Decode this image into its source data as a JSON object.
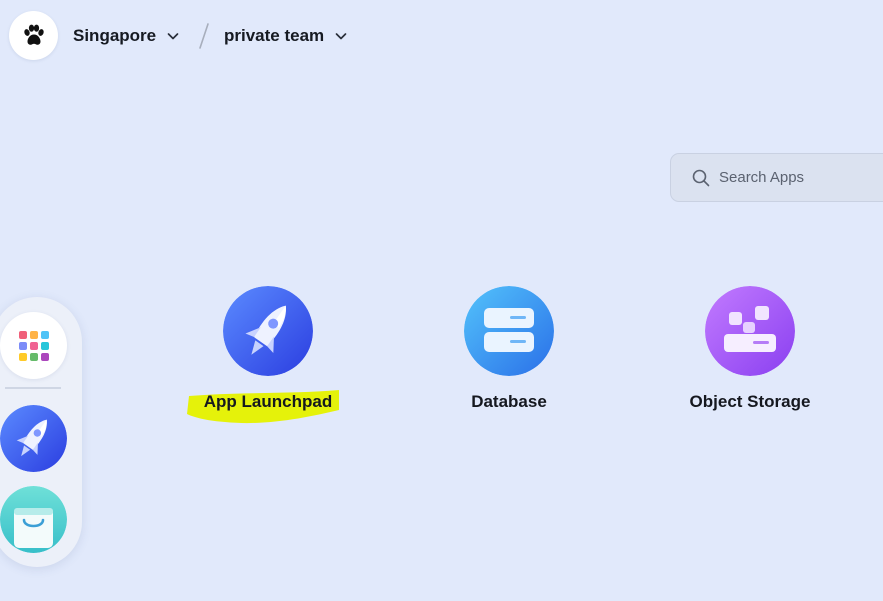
{
  "header": {
    "region": "Singapore",
    "team": "private team",
    "logo_icon": "paw-icon"
  },
  "search": {
    "placeholder": "Search Apps",
    "value": ""
  },
  "dock": {
    "items": [
      {
        "icon": "app-grid-icon"
      },
      {
        "icon": "rocket-icon"
      },
      {
        "icon": "shopping-bag-icon"
      }
    ]
  },
  "apps": [
    {
      "label": "App Launchpad",
      "icon": "rocket-icon",
      "color": "#3a5df0",
      "highlighted": true
    },
    {
      "label": "Database",
      "icon": "database-icon",
      "color": "#2f8fee"
    },
    {
      "label": "Object Storage",
      "icon": "object-storage-icon",
      "color": "#9a4ff0"
    }
  ],
  "colors": {
    "background": "#e1e9fb",
    "highlight": "#e5f20a"
  }
}
